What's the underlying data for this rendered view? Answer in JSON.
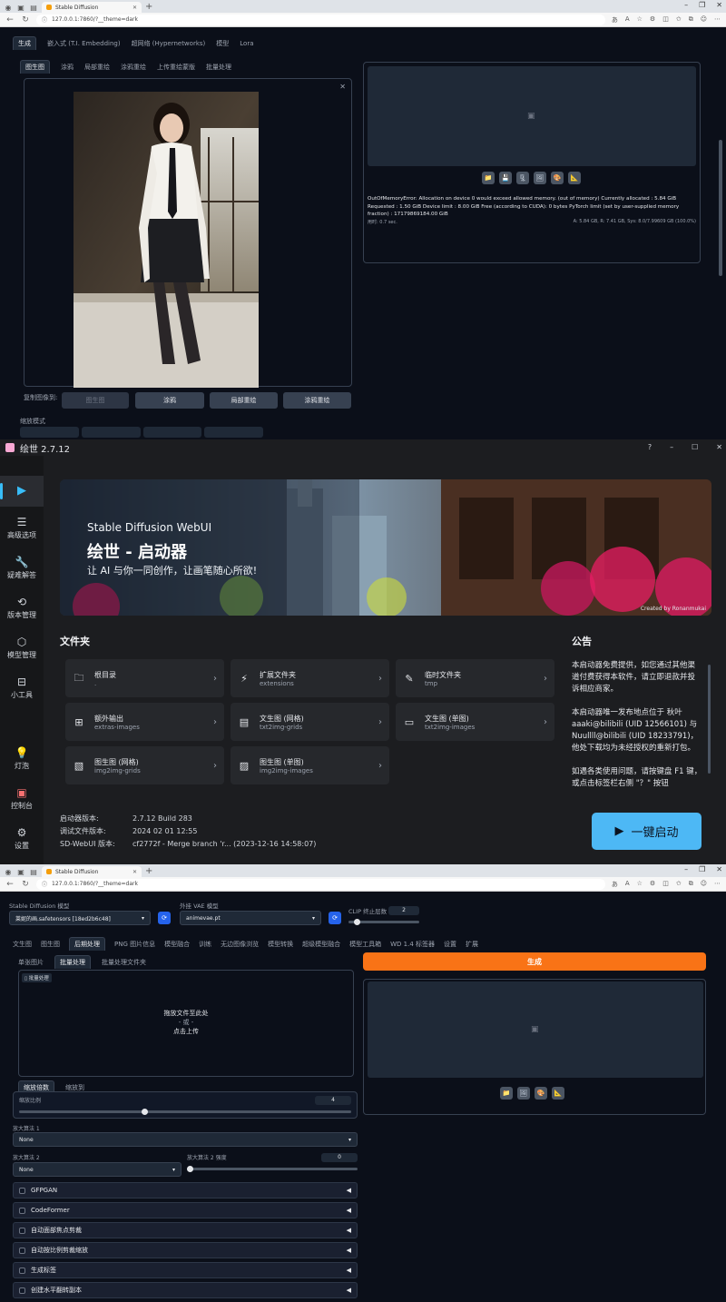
{
  "top": {
    "tab_title": "Stable Diffusion",
    "url": "127.0.0.1:7860/?__theme=dark",
    "main_tabs": [
      "生成",
      "嵌入式 (T.I. Embedding)",
      "超网络 (Hypernetworks)",
      "模型",
      "Lora"
    ],
    "sub_tabs": [
      "图生图",
      "涂鸦",
      "局部重绘",
      "涂鸦重绘",
      "上传重绘蒙版",
      "批量处理"
    ],
    "error_text": "OutOfMemoryError: Allocation on device 0 would exceed allowed memory. (out of memory) Currently allocated : 5.84 GiB Requested : 1.50 GiB Device limit : 8.00 GiB Free (according to CUDA): 0 bytes PyTorch limit (set by user-supplied memory fraction) : 17179869184.00 GiB",
    "time_taken": "用时: 0.7 sec.",
    "mem_stats": "A: 5.84 GB, R: 7.41 GB, Sys: 8.0/7.99609 GB (100.0%)",
    "copy_label": "复制图像到:",
    "copy_buttons": [
      "图生图",
      "涂鸦",
      "局部重绘",
      "涂鸦重绘"
    ],
    "resize_label": "缩放模式"
  },
  "launcher": {
    "app_title": "绘世 2.7.12",
    "sidebar": [
      {
        "label": "",
        "icon": "play-icon"
      },
      {
        "label": "高级选项",
        "icon": "list-icon"
      },
      {
        "label": "疑难解答",
        "icon": "wrench-icon"
      },
      {
        "label": "版本管理",
        "icon": "history-icon"
      },
      {
        "label": "模型管理",
        "icon": "cube-icon"
      },
      {
        "label": "小工具",
        "icon": "toolbox-icon"
      },
      {
        "label": "灯泡",
        "icon": "bulb-icon"
      },
      {
        "label": "控制台",
        "icon": "console-icon"
      },
      {
        "label": "设置",
        "icon": "gear-icon"
      }
    ],
    "banner_small": "Stable Diffusion WebUI",
    "banner_title": "绘世 - 启动器",
    "banner_sub": "让 AI 与你一同创作，让画笔随心所欲!",
    "banner_credit": "Created by Ronanmukai",
    "folders_title": "文件夹",
    "folders": [
      {
        "name": "根目录",
        "path": ".",
        "icon": "folder-icon"
      },
      {
        "name": "扩展文件夹",
        "path": "extensions",
        "icon": "plug-icon"
      },
      {
        "name": "临时文件夹",
        "path": "tmp",
        "icon": "broom-icon"
      },
      {
        "name": "额外输出",
        "path": "extras-images",
        "icon": "grid-icon"
      },
      {
        "name": "文生图 (网格)",
        "path": "txt2img-grids",
        "icon": "doc-grid-icon"
      },
      {
        "name": "文生图 (单图)",
        "path": "txt2img-images",
        "icon": "doc-icon"
      },
      {
        "name": "图生图 (网格)",
        "path": "img2img-grids",
        "icon": "image-grid-icon"
      },
      {
        "name": "图生图 (单图)",
        "path": "img2img-images",
        "icon": "image-icon"
      }
    ],
    "notice_title": "公告",
    "notice_paras": [
      "本启动器免费提供，如您通过其他渠道付费获得本软件，请立即退款并投诉相应商家。",
      "本启动器唯一发布地点位于 秋叶aaaki@bilibili (UID 12566101) 与 Nuullll@bilibili (UID 18233791)，他处下载均为未经授权的重新打包。",
      "如遇各类使用问题，请按键盘 F1 键，或点击标签栏右侧 \"？\" 按钮"
    ],
    "info": [
      {
        "k": "启动器版本:",
        "v": "2.7.12 Build 283"
      },
      {
        "k": "调试文件版本:",
        "v": "2024 02 01 12:55"
      },
      {
        "k": "SD-WebUI 版本:",
        "v": "cf2772f - Merge branch 'r... (2023-12-16 14:58:07)"
      }
    ],
    "launch_label": "一键启动"
  },
  "bottom": {
    "tab_title": "Stable Diffusion",
    "url": "127.0.0.1:7860/?__theme=dark",
    "model_label": "Stable Diffusion 模型",
    "model_value": "莱妮的画.safetensors [18ed2b6c48]",
    "vae_label": "外挂 VAE 模型",
    "vae_value": "animevae.pt",
    "clip_label": "CLIP 终止层数",
    "clip_value": "2",
    "clip_fraction": 0.08,
    "nav_tabs": [
      "文生图",
      "图生图",
      "后期处理",
      "PNG 图片信息",
      "模型融合",
      "训练",
      "无边图像浏览",
      "模型转换",
      "超级模型融合",
      "模型工具箱",
      "WD 1.4 标签器",
      "设置",
      "扩展"
    ],
    "sub_tabs": [
      "单张图片",
      "批量处理",
      "批量处理文件夹"
    ],
    "upload_tag": "批量处理",
    "drop_line1": "拖放文件至此处",
    "drop_line2": "- 或 -",
    "drop_line3": "点击上传",
    "scale_tabs": [
      "缩放倍数",
      "缩放到"
    ],
    "scale_label": "缩放比例",
    "scale_value": "4",
    "scale_fraction": 0.375,
    "upscaler1_label": "放大算法 1",
    "upscaler1_value": "None",
    "upscaler2_label": "放大算法 2",
    "upscaler2_value": "None",
    "upscaler2_vis_label": "放大算法 2 强度",
    "upscaler2_vis_value": "0",
    "upscaler2_vis_fraction": 0.0,
    "accordions": [
      "GFPGAN",
      "CodeFormer",
      "自动面部焦点剪裁",
      "自动按比例剪裁缩放",
      "生成标签",
      "创建水平翻转副本"
    ],
    "generate_label": "生成"
  }
}
